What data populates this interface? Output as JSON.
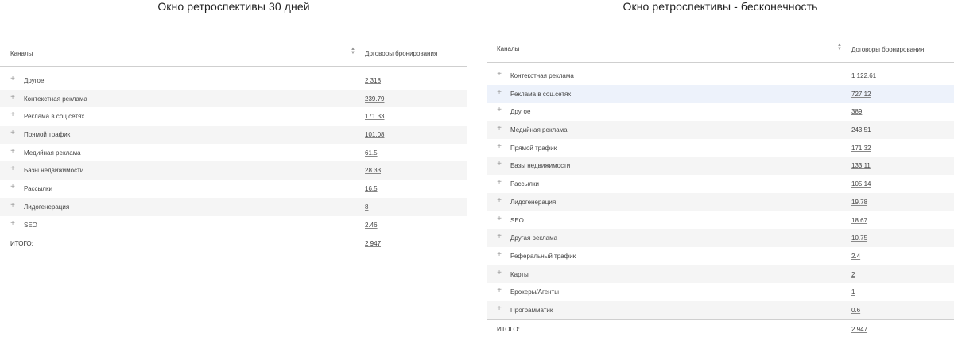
{
  "left": {
    "title": "Окно ретроспективы 30 дней",
    "header": {
      "channels": "Каналы",
      "value": "Договоры бронирования"
    },
    "rows": [
      {
        "name": "Другое",
        "value": "2 318"
      },
      {
        "name": "Контекстная реклама",
        "value": "239.79"
      },
      {
        "name": "Реклама в соц.сетях",
        "value": "171.33"
      },
      {
        "name": "Прямой трафик",
        "value": "101.08"
      },
      {
        "name": "Медийная реклама",
        "value": "61.5"
      },
      {
        "name": "Базы недвижимости",
        "value": "28.33"
      },
      {
        "name": "Рассылки",
        "value": "16.5"
      },
      {
        "name": "Лидогенерация",
        "value": "8"
      },
      {
        "name": "SEO",
        "value": "2.46"
      }
    ],
    "total": {
      "label": "ИТОГО:",
      "value": "2 947"
    }
  },
  "right": {
    "title": "Окно ретроспективы - бесконечность",
    "header": {
      "channels": "Каналы",
      "value": "Договоры бронирования"
    },
    "rows": [
      {
        "name": "Контекстная реклама",
        "value": "1 122.61"
      },
      {
        "name": "Реклама в соц.сетях",
        "value": "727.12"
      },
      {
        "name": "Другое",
        "value": "389"
      },
      {
        "name": "Медийная реклама",
        "value": "243.51"
      },
      {
        "name": "Прямой трафик",
        "value": "171.32"
      },
      {
        "name": "Базы недвижимости",
        "value": "133.11"
      },
      {
        "name": "Рассылки",
        "value": "105.14"
      },
      {
        "name": "Лидогенерация",
        "value": "19.78"
      },
      {
        "name": "SEO",
        "value": "18.67"
      },
      {
        "name": "Другая реклама",
        "value": "10.75"
      },
      {
        "name": "Реферальный трафик",
        "value": "2.4"
      },
      {
        "name": "Карты",
        "value": "2"
      },
      {
        "name": "Брокеры/Агенты",
        "value": "1"
      },
      {
        "name": "Программатик",
        "value": "0.6"
      }
    ],
    "total": {
      "label": "ИТОГО:",
      "value": "2 947"
    }
  },
  "icons": {
    "expand": "plus-icon",
    "sort": "sort-arrows-icon"
  },
  "colors": {
    "row_alt": "#f5f5f5",
    "row_highlight": "#edf2fb",
    "divider": "#cfcfcf"
  }
}
